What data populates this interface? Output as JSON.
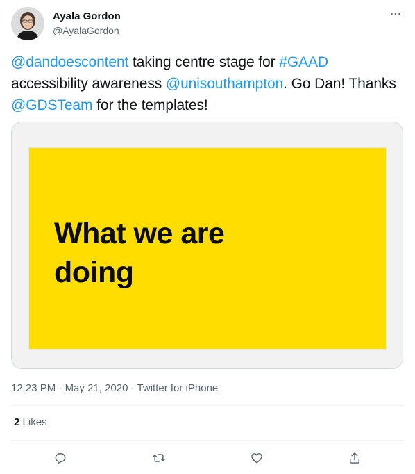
{
  "user": {
    "display_name": "Ayala Gordon",
    "handle": "@AyalaGordon"
  },
  "tweet": {
    "segments": [
      {
        "text": "@dandoescontent",
        "link": true
      },
      {
        "text": " taking centre stage for ",
        "link": false
      },
      {
        "text": "#GAAD",
        "link": true
      },
      {
        "text": " accessibility awareness ",
        "link": false
      },
      {
        "text": "@unisouthampton",
        "link": true
      },
      {
        "text": ". Go Dan! Thanks ",
        "link": false
      },
      {
        "text": "@GDSTeam",
        "link": true
      },
      {
        "text": " for the templates!",
        "link": false
      }
    ]
  },
  "media": {
    "slide_line1": "What we are",
    "slide_line2": "doing"
  },
  "meta": {
    "time": "12:23 PM",
    "separator": "·",
    "date": "May 21, 2020",
    "source": "Twitter for iPhone"
  },
  "stats": {
    "likes_count": "2",
    "likes_label": "Likes"
  },
  "icons": {
    "more": "more-icon",
    "reply": "reply-icon",
    "retweet": "retweet-icon",
    "like": "like-icon",
    "share": "share-icon"
  },
  "colors": {
    "link": "#1d9bf0",
    "slide_bg": "#ffdd00",
    "muted": "#536471",
    "text": "#0f1419"
  }
}
